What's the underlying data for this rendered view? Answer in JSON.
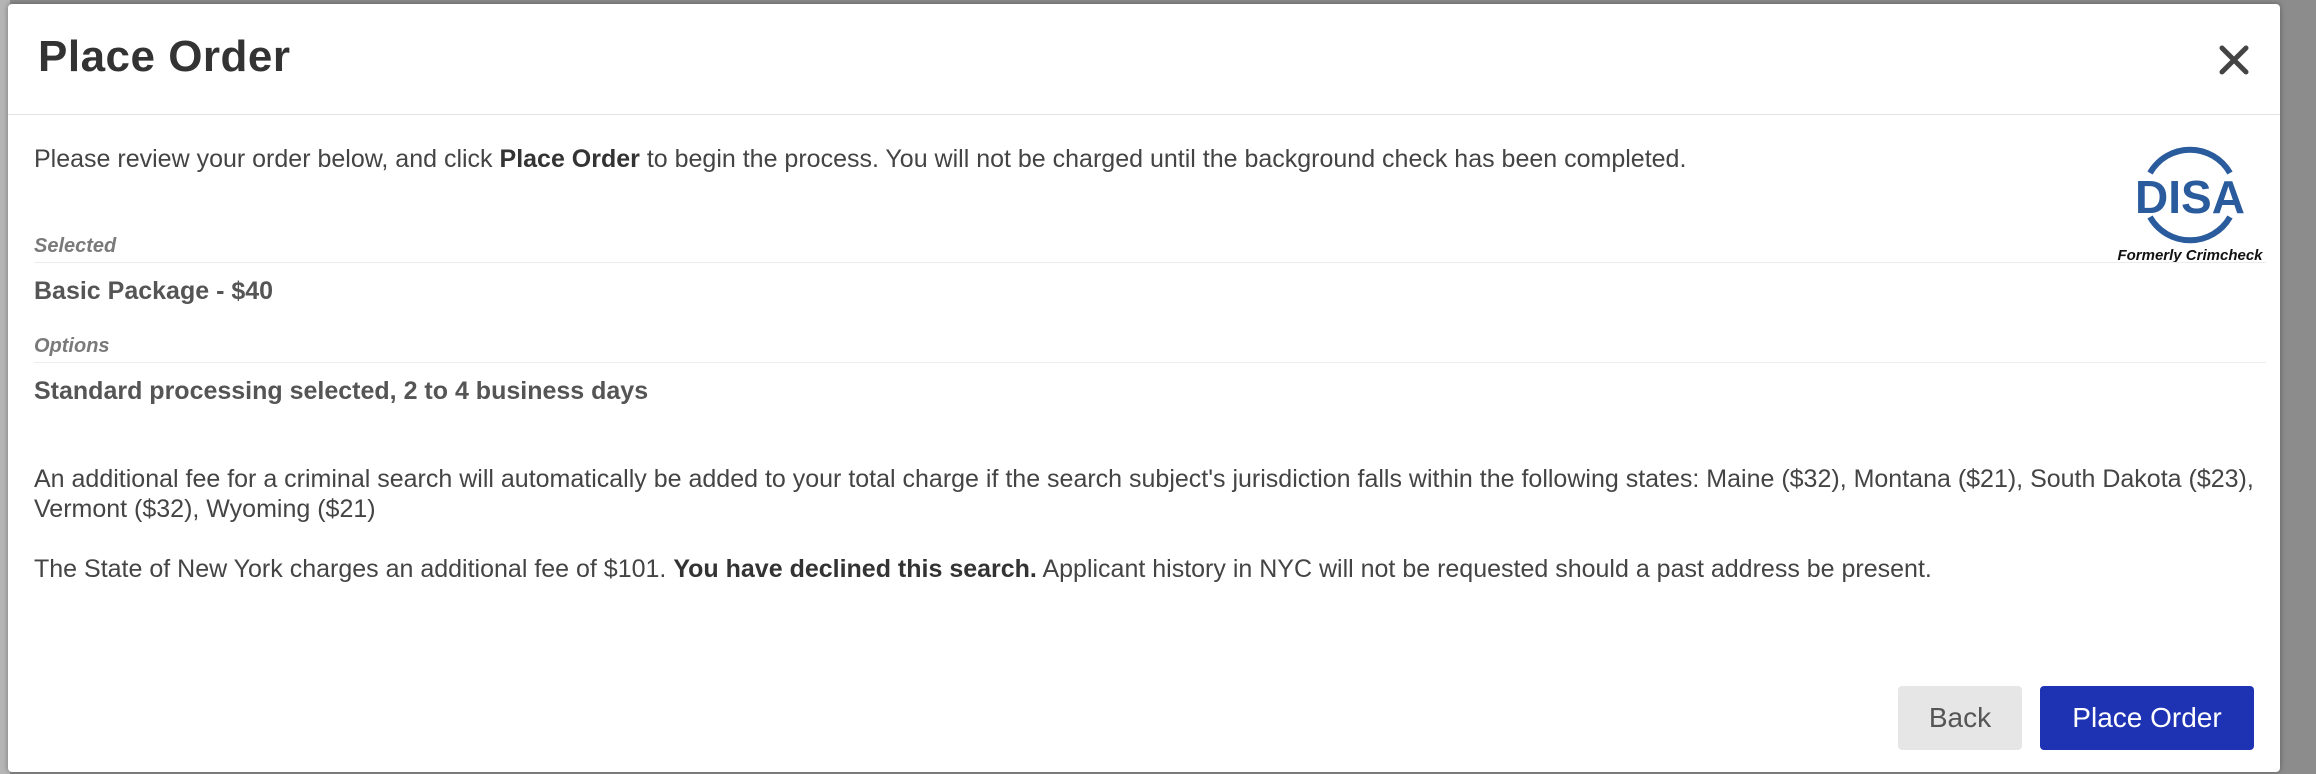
{
  "modal": {
    "title": "Place Order",
    "close_icon": "close-icon"
  },
  "intro": {
    "text_before": "Please review your order below, and click ",
    "bold": "Place Order",
    "text_after": " to begin the process. You will not be charged until the background check has been completed."
  },
  "logo": {
    "icon": "disa-logo",
    "brand": "DISA",
    "caption": "Formerly Crimcheck",
    "color": "#2a5b9c"
  },
  "selected": {
    "label": "Selected",
    "value": "Basic Package - $40"
  },
  "options": {
    "label": "Options",
    "value": "Standard processing selected, 2 to 4 business days"
  },
  "fee_notice": {
    "text": "An additional fee for a criminal search will automatically be added to your total charge if the search subject's jurisdiction falls within the following states: Maine ($32), Montana ($21), South Dakota ($23), Vermont ($32), Wyoming ($21)"
  },
  "ny_notice": {
    "text_before": "The State of New York charges an additional fee of $101. ",
    "bold": "You have declined this search.",
    "text_after": " Applicant history in NYC will not be requested should a past address be present."
  },
  "footer": {
    "back_label": "Back",
    "place_order_label": "Place Order",
    "primary_color": "#1e33b4"
  }
}
